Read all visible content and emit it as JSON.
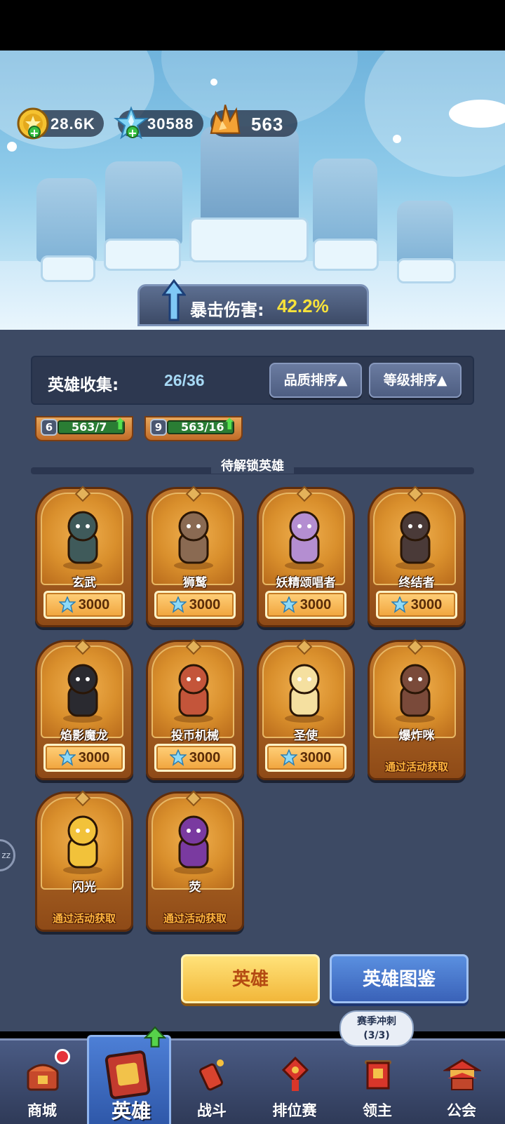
{
  "resources": {
    "gold": "28.6K",
    "crystals": "30588",
    "shards": "563"
  },
  "crit_bonus": {
    "label": "暴击伤害:",
    "value": "42.2%"
  },
  "collection": {
    "title": "英雄收集:",
    "count": "26/36",
    "sort_quality": "品质排序▲",
    "sort_level": "等级排序▲"
  },
  "owned_partial": [
    {
      "level": "6",
      "progress": "563/7"
    },
    {
      "level": "9",
      "progress": "563/16"
    }
  ],
  "pending_title": "待解锁英雄",
  "heroes": [
    {
      "name": "玄武",
      "price": "3000"
    },
    {
      "name": "狮鹫",
      "price": "3000"
    },
    {
      "name": "妖精颂唱者",
      "price": "3000"
    },
    {
      "name": "终结者",
      "price": "3000"
    },
    {
      "name": "焰影魔龙",
      "price": "3000"
    },
    {
      "name": "投币机械",
      "price": "3000"
    },
    {
      "name": "圣使",
      "price": "3000"
    },
    {
      "name": "爆炸咪",
      "event": "通过活动获取"
    },
    {
      "name": "闪光",
      "event": "通过活动获取"
    },
    {
      "name": "荧",
      "event": "通过活动获取"
    }
  ],
  "side_chip": "zz",
  "buttons": {
    "heroes": "英雄",
    "codex": "英雄图鉴"
  },
  "season_bubble": {
    "line1": "赛季冲刺",
    "line2": "(3/3)"
  },
  "nav": {
    "shop": "商城",
    "heroes": "英雄",
    "battle": "战斗",
    "ranked": "排位赛",
    "lord": "领主",
    "guild": "公会"
  },
  "colors": {
    "panel": "#3d4a64",
    "card": "#c0772c",
    "accent_yellow": "#f7e23a",
    "nav_active": "#4d7fd6"
  }
}
